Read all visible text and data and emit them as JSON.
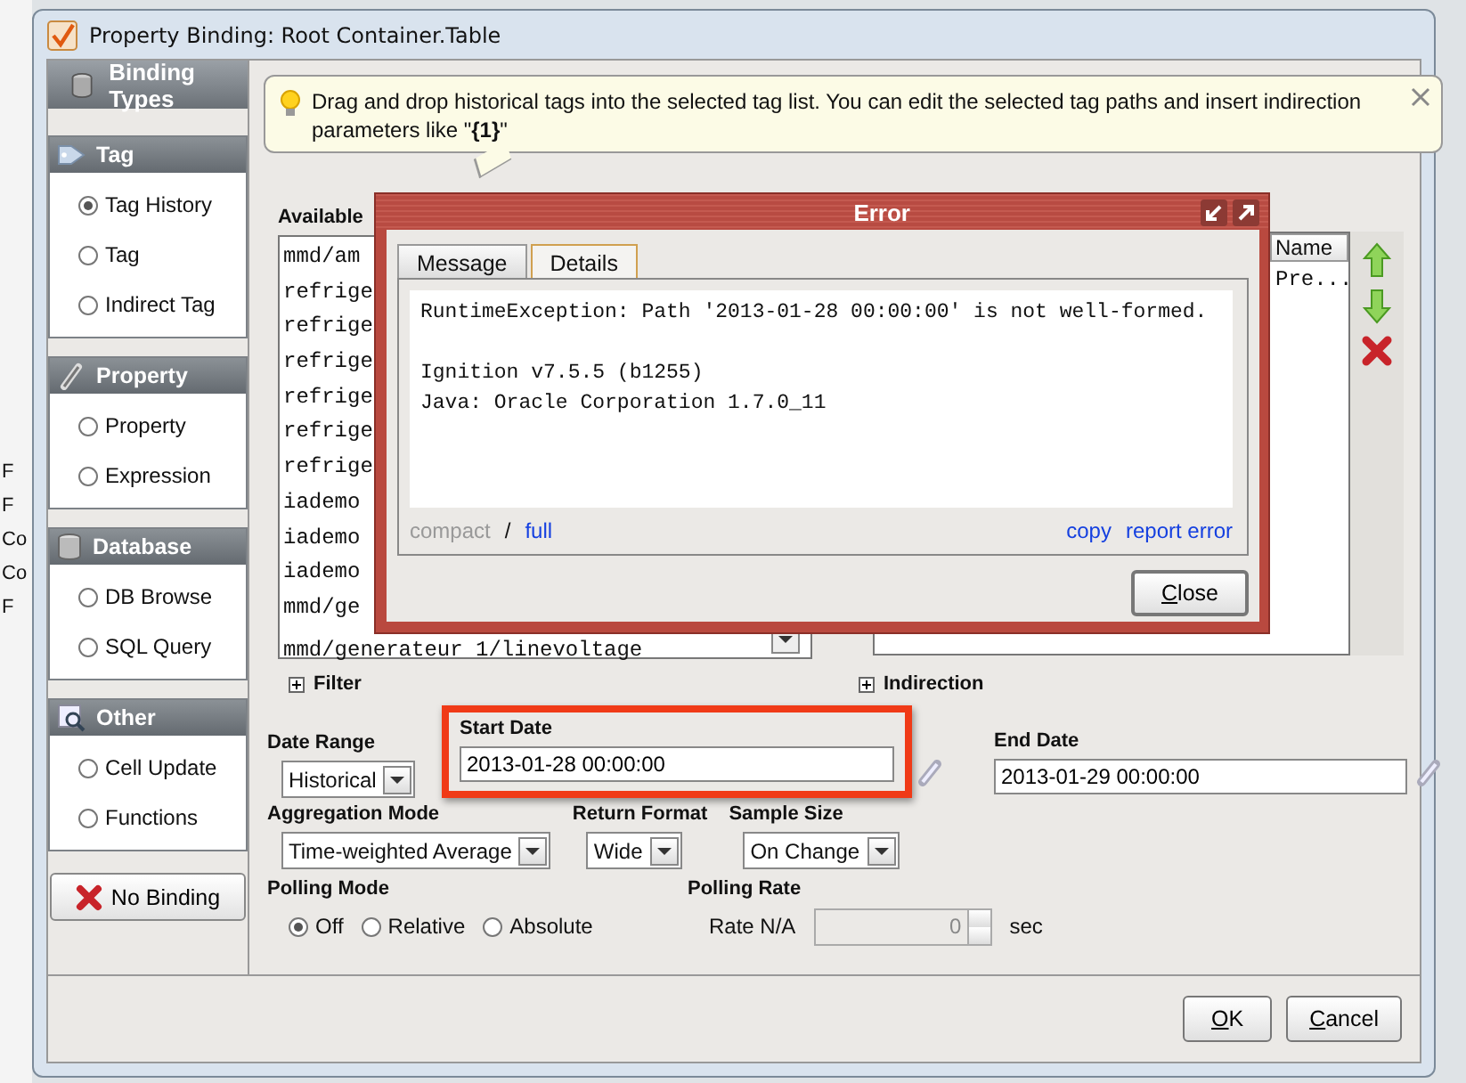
{
  "background_fragments": [
    "F",
    "F",
    "Co",
    "Co",
    "F"
  ],
  "window": {
    "title": "Property Binding: Root Container.Table"
  },
  "sidebar": {
    "title": "Binding Types",
    "groups": [
      {
        "title": "Tag",
        "options": [
          {
            "label": "Tag History",
            "selected": true
          },
          {
            "label": "Tag",
            "selected": false
          },
          {
            "label": "Indirect Tag",
            "selected": false
          }
        ]
      },
      {
        "title": "Property",
        "options": [
          {
            "label": "Property",
            "selected": false
          },
          {
            "label": "Expression",
            "selected": false
          }
        ]
      },
      {
        "title": "Database",
        "options": [
          {
            "label": "DB Browse",
            "selected": false
          },
          {
            "label": "SQL Query",
            "selected": false
          }
        ]
      },
      {
        "title": "Other",
        "options": [
          {
            "label": "Cell Update",
            "selected": false
          },
          {
            "label": "Functions",
            "selected": false
          }
        ]
      }
    ],
    "no_binding_button": "No Binding"
  },
  "tip": {
    "text": "Drag and drop historical tags into the selected tag list. You can edit the selected tag paths and insert indirection parameters like \"**{1}**\""
  },
  "available_tags": {
    "label": "Available",
    "items": [
      "mmd/am",
      "refrige",
      "refrige",
      "refrige",
      "refrige",
      "refrige",
      "refrige",
      "iademo",
      "iademo",
      "iademo",
      "mmd/ge",
      "mmd/generateur 1/linevoltage"
    ]
  },
  "selected_tags": {
    "columns": [
      "Name"
    ],
    "rows": [
      [
        "Pre..."
      ]
    ]
  },
  "filter": "Filter",
  "indirection": "Indirection",
  "date_range": {
    "label": "Date Range",
    "value": "Historical"
  },
  "start_date": {
    "label": "Start Date",
    "value": "2013-01-28 00:00:00",
    "highlighted": true
  },
  "end_date": {
    "label": "End Date",
    "value": "2013-01-29 00:00:00",
    "highlighted": false
  },
  "aggregation_mode": {
    "label": "Aggregation Mode",
    "value": "Time-weighted Average"
  },
  "return_format": {
    "label": "Return Format",
    "value": "Wide"
  },
  "sample_size": {
    "label": "Sample Size",
    "value": "On Change"
  },
  "polling_mode": {
    "label": "Polling Mode",
    "options": [
      {
        "label": "Off",
        "selected": true
      },
      {
        "label": "Relative",
        "selected": false
      },
      {
        "label": "Absolute",
        "selected": false
      }
    ]
  },
  "polling_rate": {
    "label": "Polling Rate",
    "rate_label": "Rate N/A",
    "value": "0",
    "unit": "sec",
    "disabled": true
  },
  "buttons": [
    "OK",
    "Cancel"
  ],
  "error_dialog": {
    "title": "Error",
    "tabs": [
      {
        "label": "Message",
        "selected": false
      },
      {
        "label": "Details",
        "selected": true
      }
    ],
    "paragraphs": [
      [
        "RuntimeException: Path '2013-01-28 00:00:00' is not well-formed."
      ],
      [
        "Ignition v7.5.5 (b1255)",
        "Java: Oracle Corporation 1.7.0_11"
      ]
    ],
    "compact": "compact",
    "separator": "/",
    "full": "full",
    "copy": "copy",
    "report": "report error",
    "close": "Close"
  }
}
